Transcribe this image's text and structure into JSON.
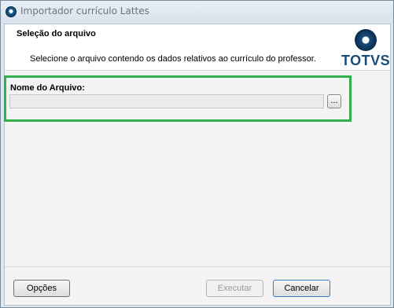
{
  "window": {
    "title": "Importador currículo Lattes"
  },
  "header": {
    "section_title": "Seleção do arquivo",
    "description": "Selecione o arquivo contendo os dados relativos ao currículo do professor.",
    "logo_text": "TOTVS"
  },
  "file": {
    "label": "Nome do Arquivo:",
    "value": "",
    "browse_label": "..."
  },
  "buttons": {
    "options": "Opções",
    "execute": "Executar",
    "cancel": "Cancelar"
  },
  "colors": {
    "highlight": "#2eb04b",
    "brand": "#1a4c7a"
  }
}
